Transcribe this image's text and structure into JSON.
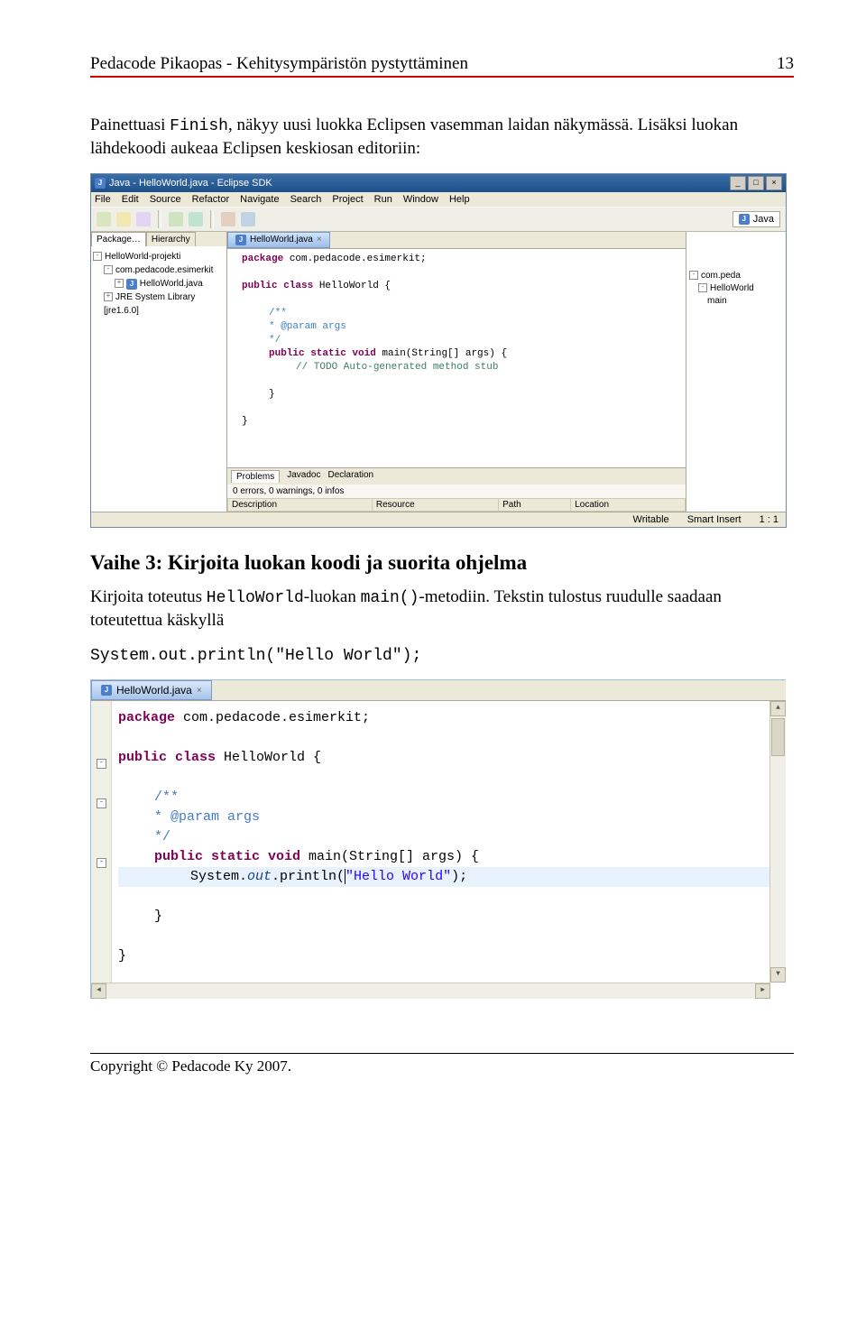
{
  "header": {
    "title": "Pedacode Pikaopas - Kehitysympäristön pystyttäminen",
    "page": "13"
  },
  "para1_pre": "Painettuasi ",
  "para1_code": "Finish",
  "para1_post": ", näkyy uusi luokka Eclipsen vasemman laidan näkymässä. Lisäksi luokan lähdekoodi aukeaa Eclipsen keskiosan editoriin:",
  "ide": {
    "title": "Java - HelloWorld.java - Eclipse SDK",
    "menu": [
      "File",
      "Edit",
      "Source",
      "Refactor",
      "Navigate",
      "Search",
      "Project",
      "Run",
      "Window",
      "Help"
    ],
    "perspective": "Java",
    "left_tabs": [
      "Package…",
      "Hierarchy"
    ],
    "tree": {
      "project": "HelloWorld-projekti",
      "pkg": "com.pedacode.esimerkit",
      "file": "HelloWorld.java",
      "lib": "JRE System Library [jre1.6.0]"
    },
    "editor_tab": "HelloWorld.java",
    "code": {
      "l1a": "package",
      "l1b": " com.pedacode.esimerkit;",
      "l2a": "public class",
      "l2b": " HelloWorld {",
      "l3": "/**",
      "l4": " * @param args",
      "l5": " */",
      "l6a": "public static void",
      "l6b": " main(String[] args) {",
      "l7": "// TODO Auto-generated method stub",
      "l8": "}",
      "l9": "}"
    },
    "outline": {
      "pkg": "com.peda",
      "cls": "HelloWorld",
      "m": "main"
    },
    "problems_tabs": [
      "Problems",
      "Javadoc",
      "Declaration"
    ],
    "problems_status": "0 errors, 0 warnings, 0 infos",
    "problems_cols": [
      "Description",
      "Resource",
      "Path",
      "Location"
    ],
    "status": {
      "writable": "Writable",
      "insert": "Smart Insert",
      "pos": "1 : 1"
    }
  },
  "h2": "Vaihe 3: Kirjoita luokan koodi ja suorita ohjelma",
  "para2_a": "Kirjoita toteutus ",
  "para2_b": "HelloWorld",
  "para2_c": "-luokan ",
  "para2_d": "main()",
  "para2_e": "-metodiin. Tekstin tulostus ruudulle saadaan toteutettua käskyllä",
  "codeLine": "System.out.println(\"Hello World\");",
  "editor2": {
    "tab": "HelloWorld.java",
    "l1a": "package",
    "l1b": " com.pedacode.esimerkit;",
    "l2a": "public class",
    "l2b": " HelloWorld {",
    "l3": "/**",
    "l4": " * @param args",
    "l5": " */",
    "l6a": "public static void",
    "l6b": " main(String[] args) {",
    "l7a": "System.",
    "l7b": "out",
    "l7c": ".println(",
    "l7d": "\"Hello World\"",
    "l7e": ");",
    "l8": "}",
    "l9": "}"
  },
  "footer": "Copyright © Pedacode Ky 2007."
}
